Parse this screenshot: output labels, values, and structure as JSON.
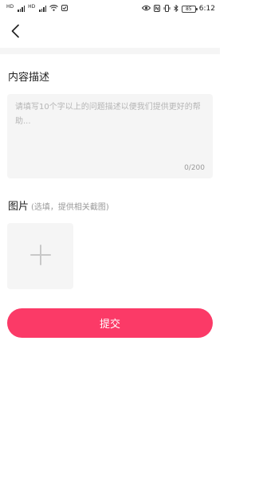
{
  "status_bar": {
    "carrier_tag_1": "HD",
    "carrier_tag_2": "HD",
    "battery": "85",
    "time": "6:12"
  },
  "icons": {
    "back": "back-arrow-icon",
    "add": "plus-icon",
    "eye": "eye-icon",
    "nfc": "nfc-icon",
    "vibrate": "vibrate-icon",
    "bluetooth": "bluetooth-icon",
    "wifi": "wifi-icon",
    "signal": "signal-icon"
  },
  "form": {
    "description": {
      "title": "内容描述",
      "placeholder": "请填写10个字以上的问题描述以便我们提供更好的帮助...",
      "value": "",
      "char_count": "0/200"
    },
    "images": {
      "title": "图片",
      "hint": "(选填，提供相关截图)"
    },
    "submit_label": "提交"
  },
  "colors": {
    "accent": "#fb3a67",
    "input_bg": "#f5f5f5",
    "placeholder": "#b5b5b5"
  }
}
